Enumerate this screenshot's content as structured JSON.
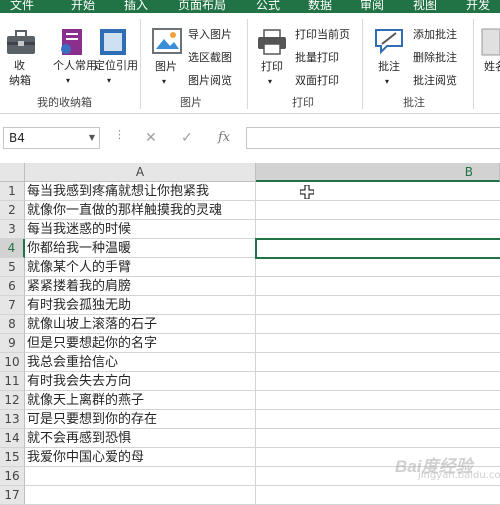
{
  "tabs": [
    "文件",
    "开始",
    "插入",
    "页面布局",
    "公式",
    "数据",
    "审阅",
    "视图",
    "开发工"
  ],
  "ribbon": {
    "groups": [
      {
        "label": "我的收纳箱",
        "buttons": [
          "收纳箱",
          "个人常用",
          "定位引用"
        ]
      },
      {
        "label": "图片",
        "big": "图片",
        "small": [
          "导入图片",
          "选区截图",
          "图片阅览"
        ]
      },
      {
        "label": "打印",
        "big": "打印",
        "small": [
          "打印当前页",
          "批量打印",
          "双面打印"
        ]
      },
      {
        "label": "批注",
        "big": "批注",
        "small": [
          "添加批注",
          "删除批注",
          "批注阅览"
        ]
      }
    ],
    "partial_button": "姓名"
  },
  "formula_bar": {
    "name_box": "B4",
    "fx": "fx",
    "cancel": "✕",
    "enter": "✓",
    "value": ""
  },
  "grid": {
    "columns": [
      "A",
      "B"
    ],
    "selected_column": "B",
    "selected_cell": "B4",
    "rows": [
      {
        "n": "1",
        "a": "每当我感到疼痛就想让你抱紧我"
      },
      {
        "n": "2",
        "a": "就像你一直做的那样触摸我的灵魂"
      },
      {
        "n": "3",
        "a": "每当我迷惑的时候"
      },
      {
        "n": "4",
        "a": "你都给我一种温暖"
      },
      {
        "n": "5",
        "a": "就像某个人的手臂"
      },
      {
        "n": "6",
        "a": "紧紧搂着我的肩膀"
      },
      {
        "n": "7",
        "a": "有时我会孤独无助"
      },
      {
        "n": "8",
        "a": "就像山坡上滚落的石子"
      },
      {
        "n": "9",
        "a": "但是只要想起你的名字"
      },
      {
        "n": "10",
        "a": "我总会重拾信心"
      },
      {
        "n": "11",
        "a": "有时我会失去方向"
      },
      {
        "n": "12",
        "a": "就像天上离群的燕子"
      },
      {
        "n": "13",
        "a": "可是只要想到你的存在"
      },
      {
        "n": "14",
        "a": "就不会再感到恐惧"
      },
      {
        "n": "15",
        "a": "我爱你中国心爱的母"
      },
      {
        "n": "16",
        "a": ""
      },
      {
        "n": "17",
        "a": ""
      }
    ]
  },
  "watermark": "Bai度经验",
  "watermark_sub": "jingyan.baidu.com"
}
